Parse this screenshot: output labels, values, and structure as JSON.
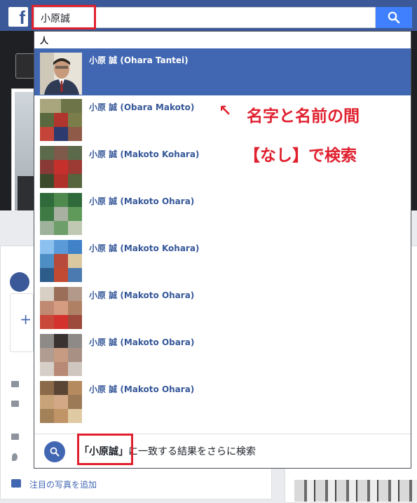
{
  "topbar": {
    "logo": "f",
    "search_value": "小原誠",
    "search_button_icon": "search-icon"
  },
  "dropdown": {
    "section_header": "人",
    "results": [
      {
        "name": "小原 誠 (Ohara Tantei)",
        "active": true
      },
      {
        "name": "小原 誠 (Obara Makoto)"
      },
      {
        "name": "小原 誠 (Makoto Kohara)"
      },
      {
        "name": "小原 誠 (Makoto Ohara)"
      },
      {
        "name": "小原 誠 (Makoto Kohara)"
      },
      {
        "name": "小原 誠 (Makoto Ohara)"
      },
      {
        "name": "小原 誠 (Makoto Obara)"
      },
      {
        "name": "小原 誠 (Makoto Ohara)"
      }
    ],
    "footer": {
      "query": "「小原誠」",
      "suffix": "に一致する結果をさらに検索"
    }
  },
  "annotation": {
    "arrow": "↖",
    "line1": "名字と名前の間",
    "line2": "【なし】で検索"
  },
  "background": {
    "add_photo_label": "注目の写真を追加",
    "plus": "+"
  },
  "colors": {
    "facebook_blue": "#3b5998",
    "active_row": "#4267b2",
    "annotation_red": "#e0202e",
    "search_button": "#4080ff"
  }
}
